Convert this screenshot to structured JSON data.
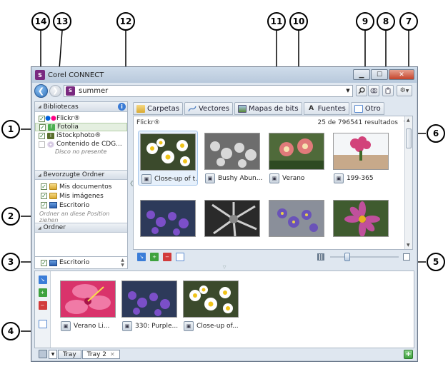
{
  "window": {
    "title": "Corel CONNECT",
    "logo_glyph": "S"
  },
  "toolbar": {
    "search_value": "summer",
    "back_glyph": "❮",
    "forward_glyph": "❯"
  },
  "libraries": {
    "header": "Bibliotecas",
    "items": [
      {
        "label": "Flickr®",
        "checked": true
      },
      {
        "label": "Fotolia",
        "checked": true
      },
      {
        "label": "iStockphoto®",
        "checked": true
      },
      {
        "label": "Contenido de CDG...",
        "checked": false
      }
    ],
    "note": "Disco no presente"
  },
  "favorites": {
    "header": "Bevorzugte Ordner",
    "items": [
      {
        "label": "Mis documentos"
      },
      {
        "label": "Mis imágenes"
      },
      {
        "label": "Escritorio"
      }
    ],
    "drop_hint": "Ordner an diese Position ziehen"
  },
  "folders": {
    "header": "Ordner",
    "current": "Escritorio"
  },
  "tabs": [
    {
      "label": "Carpetas"
    },
    {
      "label": "Vectores"
    },
    {
      "label": "Mapas de bits"
    },
    {
      "label": "Fuentes"
    },
    {
      "label": "Otro"
    }
  ],
  "content": {
    "source_label": "Flickr®",
    "results": "25 de 796541 resultados",
    "items": [
      {
        "caption": "Close-up of t..."
      },
      {
        "caption": "Bushy Abun..."
      },
      {
        "caption": "Verano"
      },
      {
        "caption": "199-365"
      },
      {
        "caption": ""
      },
      {
        "caption": ""
      },
      {
        "caption": ""
      },
      {
        "caption": ""
      }
    ],
    "zoom_level": 0.25
  },
  "tray": {
    "items": [
      {
        "caption": "Verano  Li..."
      },
      {
        "caption": "330: Purple..."
      },
      {
        "caption": "Close-up of..."
      }
    ],
    "tabs": [
      {
        "label": "Tray"
      },
      {
        "label": "Tray 2"
      }
    ]
  },
  "callouts": [
    "1",
    "2",
    "3",
    "4",
    "5",
    "6",
    "7",
    "8",
    "9",
    "10",
    "11",
    "12",
    "13",
    "14"
  ],
  "colors": {
    "accent": "#3a7bd5",
    "brand": "#7a2a80",
    "check": "#2e7d32"
  }
}
